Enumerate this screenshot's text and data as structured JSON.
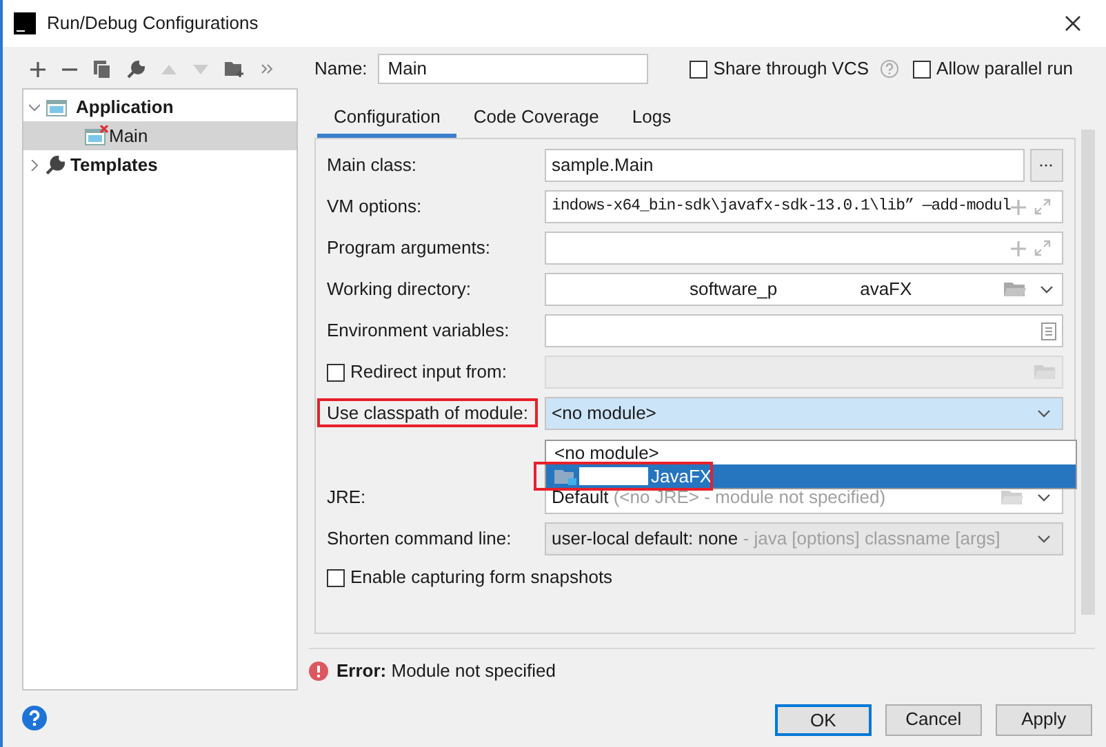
{
  "window": {
    "title": "Run/Debug Configurations"
  },
  "tree": [
    {
      "label": "Application",
      "expanded": true,
      "selected": false,
      "children": [
        {
          "label": "Main",
          "selected": true,
          "error": true
        }
      ]
    },
    {
      "label": "Templates",
      "expanded": false,
      "selected": false
    }
  ],
  "name": {
    "label": "Name:",
    "value": "Main"
  },
  "options": [
    {
      "label": "Share through VCS",
      "checked": false,
      "help": true
    },
    {
      "label": "Allow parallel run",
      "checked": false
    }
  ],
  "tabs": [
    {
      "label": "Configuration",
      "selected": true
    },
    {
      "label": "Code Coverage",
      "selected": false
    },
    {
      "label": "Logs",
      "selected": false
    }
  ],
  "fields": [
    {
      "kind": "text",
      "label": "Main class:",
      "value": "sample.Main"
    },
    {
      "kind": "expandable",
      "label": "VM options:",
      "value": "indows-x64_bin-sdk\\javafx-sdk-13.0.1\\lib” —add-modul"
    },
    {
      "kind": "expandable",
      "label": "Program arguments:"
    },
    {
      "kind": "directory",
      "label": "Working directory:",
      "value_parts": [
        "software_p",
        "avaFX"
      ]
    },
    {
      "kind": "environment",
      "label": "Environment variables:"
    },
    {
      "kind": "redirect",
      "label": "Redirect input from:",
      "checked": false
    },
    {
      "kind": "module",
      "label": "Use classpath of module:",
      "value": "<no module>",
      "highlighted": true
    },
    {
      "kind": "jre",
      "label": "JRE:",
      "value": "Default",
      "hint": "(<no JRE> - module not specified)"
    },
    {
      "kind": "shorten",
      "label": "Shorten command line:",
      "value": "user-local default: none",
      "hint": "- java [options] classname [args]"
    },
    {
      "kind": "checkbox",
      "label": "Enable capturing form snapshots",
      "checked": false
    }
  ],
  "dropdown": {
    "options": [
      {
        "label": "<no module>",
        "selected": false,
        "highlighted": false,
        "redacted": false
      },
      {
        "label": "JavaFX",
        "selected": true,
        "highlighted": true,
        "redacted": true
      }
    ]
  },
  "error": {
    "text": "**Error:** Module not specified"
  },
  "buttons": [
    {
      "label": "OK",
      "default": true
    },
    {
      "label": "Cancel",
      "default": false
    },
    {
      "label": "Apply",
      "default": false
    }
  ]
}
